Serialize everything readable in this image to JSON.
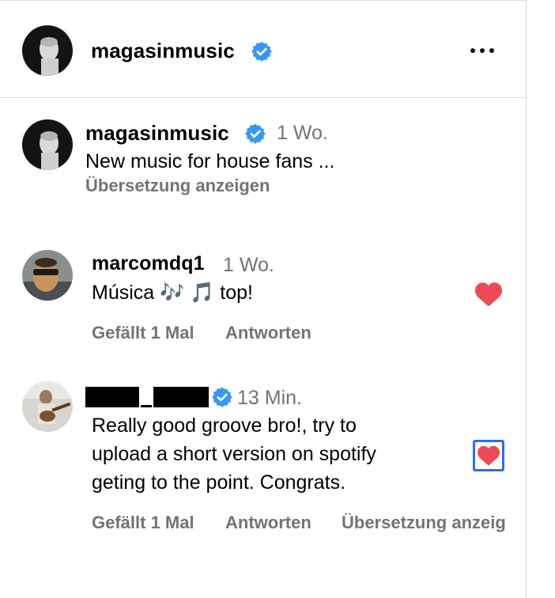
{
  "post": {
    "username": "magasinmusic",
    "more_icon": "more-horizontal-icon"
  },
  "caption": {
    "username": "magasinmusic",
    "time": "1 Wo.",
    "text": "New music for house fans ...",
    "translate_label": "Übersetzung anzeigen"
  },
  "comments": [
    {
      "username": "marcomdq1",
      "time": "1 Wo.",
      "text": "Música 🎶 🎵 top!",
      "likes_label": "Gefällt 1 Mal",
      "reply_label": "Antworten",
      "liked": true
    },
    {
      "username_redacted": true,
      "time": "13 Min.",
      "text_lines": [
        "Really good groove bro!, try to",
        "upload a short version on spotify",
        "geting to the point. Congrats."
      ],
      "likes_label": "Gefällt 1 Mal",
      "reply_label": "Antworten",
      "translate_label": "Übersetzung anzeig",
      "liked": true
    }
  ],
  "colors": {
    "verified_blue": "#3897f0",
    "heart_red": "#ed4956",
    "focus_ring": "#2d6ee6",
    "secondary_text": "#737373",
    "divider": "#dbdbdb"
  }
}
